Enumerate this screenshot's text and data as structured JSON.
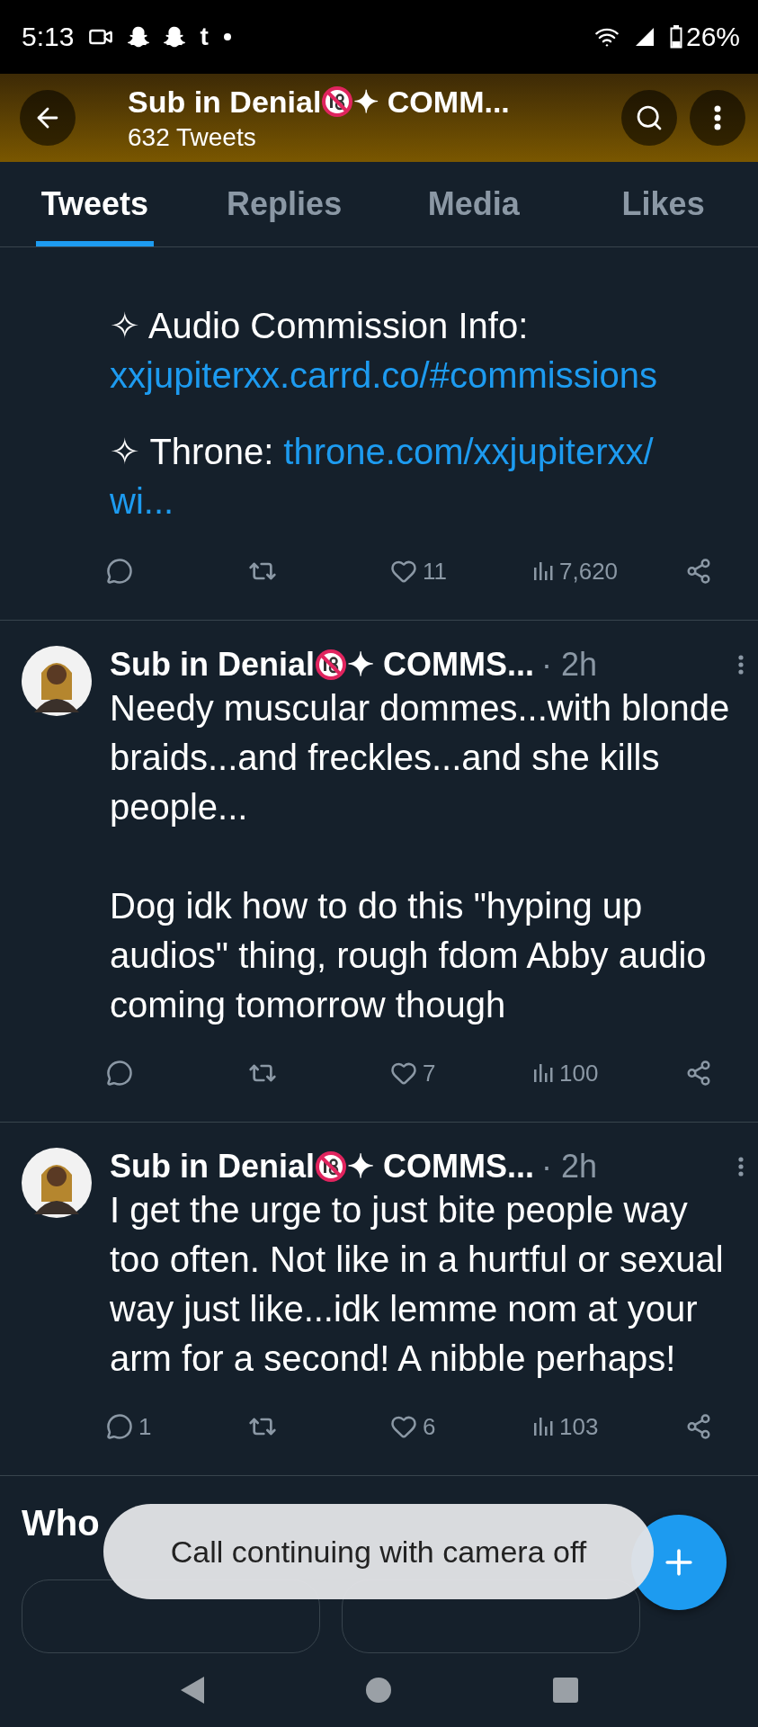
{
  "status_bar": {
    "time": "5:13",
    "app_letter": "t",
    "battery": "26%"
  },
  "header": {
    "name": "Sub in Denial",
    "name_suffix": "✦ COMM...",
    "subtitle": "632 Tweets"
  },
  "tabs": [
    {
      "label": "Tweets",
      "selected": true
    },
    {
      "label": "Replies",
      "selected": false
    },
    {
      "label": "Media",
      "selected": false
    },
    {
      "label": "Likes",
      "selected": false
    }
  ],
  "tweets": [
    {
      "kind": "continuation",
      "paragraphs": [
        [
          {
            "kind": "text",
            "text": "✧ Audio Commission Info:"
          },
          {
            "kind": "link",
            "text": "xxjupiterxx.carrd.co/#commissions"
          }
        ],
        [
          {
            "kind": "text",
            "text": "✧ Throne: "
          },
          {
            "kind": "link",
            "text": "throne.com/xxjupiterxx/"
          },
          {
            "kind": "link",
            "text": "wi..."
          }
        ]
      ],
      "likes": "11",
      "views": "7,620"
    },
    {
      "kind": "full",
      "name": "Sub in Denial",
      "name_suffix": "✦ COMMS...",
      "time": "· 2h",
      "paragraphs": [
        [
          {
            "kind": "text",
            "text": "Needy muscular dommes...with blonde braids...and freckles...and she kills people..."
          }
        ],
        [
          {
            "kind": "text",
            "text": "Dog idk how to do this \"hyping up audios\" thing, rough fdom Abby audio coming tomorrow though"
          }
        ]
      ],
      "likes": "7",
      "views": "100"
    },
    {
      "kind": "full",
      "name": "Sub in Denial",
      "name_suffix": "✦ COMMS...",
      "time": "· 2h",
      "paragraphs": [
        [
          {
            "kind": "text",
            "text": "I get the urge to just bite people way too often. Not like in a hurtful or sexual way just like...idk lemme nom at your arm for a second! A nibble perhaps!"
          }
        ]
      ],
      "replies": "1",
      "likes": "6",
      "views": "103"
    }
  ],
  "who_to_follow": {
    "title": "Who"
  },
  "toast": {
    "message": "Call continuing with camera off"
  }
}
